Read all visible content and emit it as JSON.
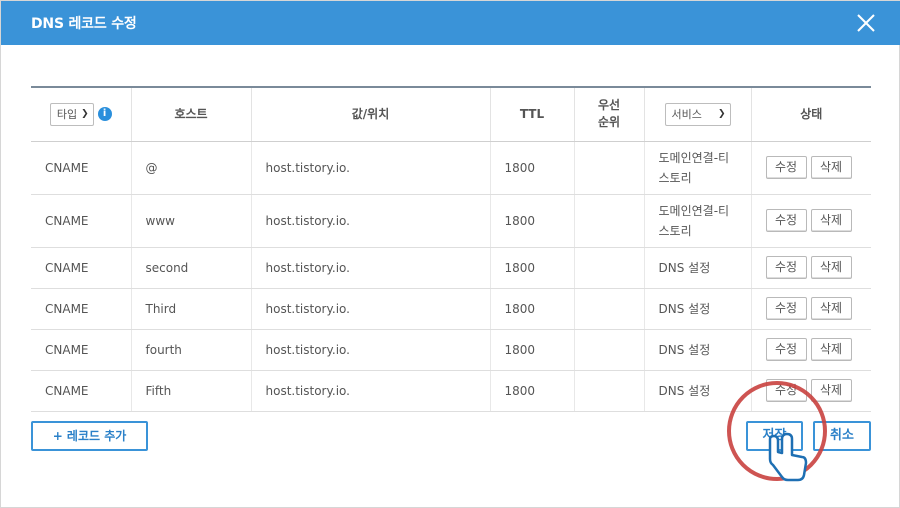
{
  "dialog": {
    "title": "DNS 레코드 수정",
    "accent_color": "#3a93d8",
    "close_icon": "close-icon"
  },
  "table": {
    "headers": {
      "type_select": "타입",
      "host": "호스트",
      "value": "값/위치",
      "ttl": "TTL",
      "priority": "우선\n순위",
      "service_select": "서비스",
      "state": "상태"
    },
    "rows": [
      {
        "type": "CNAME",
        "host": "@",
        "value": "host.tistory.io.",
        "ttl": "1800",
        "priority": "",
        "service": "도메인연결-티\n스토리",
        "edit": "수정",
        "delete": "삭제"
      },
      {
        "type": "CNAME",
        "host": "www",
        "value": "host.tistory.io.",
        "ttl": "1800",
        "priority": "",
        "service": "도메인연결-티\n스토리",
        "edit": "수정",
        "delete": "삭제"
      },
      {
        "type": "CNAME",
        "host": "second",
        "value": "host.tistory.io.",
        "ttl": "1800",
        "priority": "",
        "service": "DNS 설정",
        "edit": "수정",
        "delete": "삭제"
      },
      {
        "type": "CNAME",
        "host": "Third",
        "value": "host.tistory.io.",
        "ttl": "1800",
        "priority": "",
        "service": "DNS 설정",
        "edit": "수정",
        "delete": "삭제"
      },
      {
        "type": "CNAME",
        "host": "fourth",
        "value": "host.tistory.io.",
        "ttl": "1800",
        "priority": "",
        "service": "DNS 설정",
        "edit": "수정",
        "delete": "삭제"
      },
      {
        "type": "CNAME",
        "host": "Fifth",
        "value": "host.tistory.io.",
        "ttl": "1800",
        "priority": "",
        "service": "DNS 설정",
        "edit": "수정",
        "delete": "삭제"
      }
    ]
  },
  "footer": {
    "add_record": "+ 레코드 추가",
    "save": "저장",
    "cancel": "취소"
  }
}
